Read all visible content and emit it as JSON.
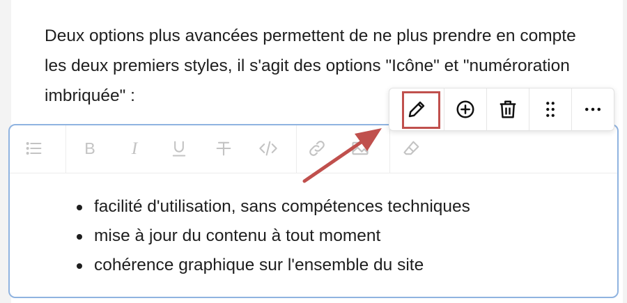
{
  "intro_text": "Deux options plus avancées permettent de ne plus prendre en compte les deux premiers styles, il s'agit des options \"Icône\" et \"numéroration imbriquée\" :",
  "list_items": [
    "facilité d'utilisation, sans compétences techniques",
    "mise à jour du contenu à tout moment",
    "cohérence graphique sur l'ensemble du site"
  ],
  "format_toolbar_icons": [
    "list-icon",
    "bold-icon",
    "italic-icon",
    "underline-icon",
    "strikethrough-icon",
    "code-icon",
    "link-icon",
    "image-icon",
    "eraser-icon"
  ],
  "block_toolbar_icons": [
    "pencil-icon",
    "plus-circle-icon",
    "trash-icon",
    "drag-handle-icon",
    "more-icon"
  ],
  "colors": {
    "editor_border": "#8fb3e0",
    "annotation": "#c0504d",
    "disabled_icon": "#c3c3c3"
  }
}
